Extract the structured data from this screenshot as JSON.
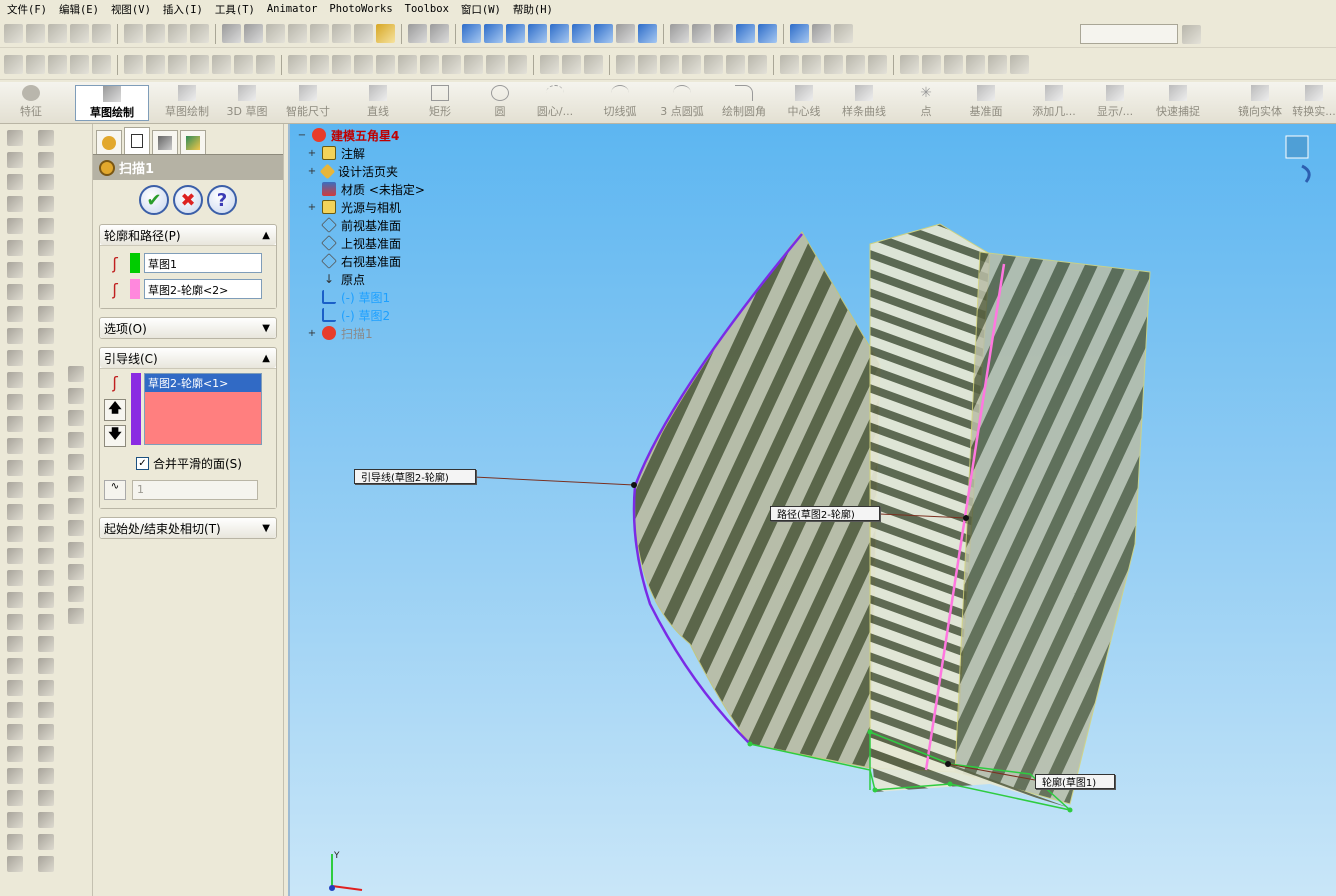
{
  "menu": {
    "items": [
      "文件(F)",
      "编辑(E)",
      "视图(V)",
      "插入(I)",
      "工具(T)",
      "Animator",
      "PhotoWorks",
      "Toolbox",
      "窗口(W)",
      "帮助(H)"
    ]
  },
  "command_manager": {
    "tabs": [
      {
        "label": "特征",
        "active": false
      },
      {
        "label": "草图绘制",
        "active": true
      },
      {
        "label": "草图绘制",
        "active": false
      },
      {
        "label": "3D 草图",
        "active": false
      },
      {
        "label": "智能尺寸",
        "active": false
      },
      {
        "label": "直线",
        "active": false
      },
      {
        "label": "矩形",
        "active": false
      },
      {
        "label": "圆",
        "active": false
      },
      {
        "label": "圆心/...",
        "active": false
      },
      {
        "label": "切线弧",
        "active": false
      },
      {
        "label": "3 点圆弧",
        "active": false
      },
      {
        "label": "绘制圆角",
        "active": false
      },
      {
        "label": "中心线",
        "active": false
      },
      {
        "label": "样条曲线",
        "active": false
      },
      {
        "label": "点",
        "active": false
      },
      {
        "label": "基准面",
        "active": false
      },
      {
        "label": "添加几...",
        "active": false
      },
      {
        "label": "显示/...",
        "active": false
      },
      {
        "label": "快速捕捉",
        "active": false
      },
      {
        "label": "镜向实体",
        "active": false
      },
      {
        "label": "转换实...",
        "active": false
      }
    ]
  },
  "property_manager": {
    "title": "扫描1",
    "ok_icon": "check-icon",
    "cancel_icon": "x-icon",
    "help_icon": "?",
    "groups": {
      "profile_path": {
        "label": "轮廓和路径(P)",
        "profile_value": "草图1",
        "path_value": "草图2-轮廓<2>",
        "profile_color": "#00cc00",
        "path_color": "#ff88dd"
      },
      "options": {
        "label": "选项(O)"
      },
      "guide": {
        "label": "引导线(C)",
        "items": [
          "草图2-轮廓<1>"
        ],
        "merge_smooth_label": "合并平滑的面(S)",
        "merge_smooth_checked": true,
        "tangent_count": "1",
        "guide_color": "#8a2be2"
      },
      "tangency": {
        "label": "起始处/结束处相切(T)"
      }
    }
  },
  "feature_tree": {
    "root": "建模五角星4",
    "nodes": [
      {
        "label": "注解",
        "expand": "+",
        "icon": "annotation-icon"
      },
      {
        "label": "设计活页夹",
        "expand": "+",
        "icon": "design-binder-icon"
      },
      {
        "label": "材质 <未指定>",
        "expand": "",
        "icon": "material-icon"
      },
      {
        "label": "光源与相机",
        "expand": "+",
        "icon": "lights-camera-icon"
      },
      {
        "label": "前视基准面",
        "expand": "",
        "icon": "plane-icon"
      },
      {
        "label": "上视基准面",
        "expand": "",
        "icon": "plane-icon"
      },
      {
        "label": "右视基准面",
        "expand": "",
        "icon": "plane-icon"
      },
      {
        "label": "原点",
        "expand": "",
        "icon": "origin-icon"
      },
      {
        "label": "(-) 草图1",
        "expand": "",
        "icon": "sketch-icon"
      },
      {
        "label": "(-) 草图2",
        "expand": "",
        "icon": "sketch-icon"
      },
      {
        "label": "扫描1",
        "expand": "+",
        "icon": "sweep-error-icon"
      }
    ]
  },
  "callouts": {
    "guide": "引导线(草图2-轮廓)",
    "path": "路径(草图2-轮廓)",
    "profile": "轮廓(草图1)"
  }
}
